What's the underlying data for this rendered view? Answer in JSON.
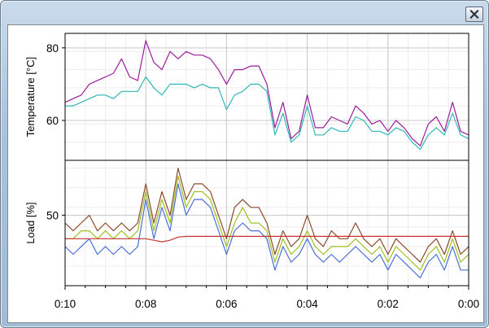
{
  "window": {
    "close_icon": "close-icon"
  },
  "chart_data": [
    {
      "type": "line",
      "ylabel": "Temperature [°C]",
      "xlabel": "",
      "x_ticks": [
        "0:10",
        "0:08",
        "0:06",
        "0:04",
        "0:02",
        "0:00"
      ],
      "y_ticks": [
        60,
        80
      ],
      "xlim": [
        10,
        0
      ],
      "ylim": [
        49,
        84
      ],
      "grid": true,
      "x": [
        10.0,
        9.8,
        9.6,
        9.4,
        9.2,
        9.0,
        8.8,
        8.6,
        8.4,
        8.2,
        8.0,
        7.8,
        7.6,
        7.4,
        7.2,
        7.0,
        6.8,
        6.6,
        6.4,
        6.2,
        6.0,
        5.8,
        5.6,
        5.4,
        5.2,
        5.0,
        4.8,
        4.6,
        4.4,
        4.2,
        4.0,
        3.8,
        3.6,
        3.4,
        3.2,
        3.0,
        2.8,
        2.6,
        2.4,
        2.2,
        2.0,
        1.8,
        1.6,
        1.4,
        1.2,
        1.0,
        0.8,
        0.6,
        0.4,
        0.2,
        0.0
      ],
      "series": [
        {
          "color": "#9c1c9c",
          "values": [
            65,
            66,
            67,
            70,
            71,
            72,
            73,
            77,
            72,
            71,
            82,
            76,
            74,
            79,
            77,
            79,
            78,
            78,
            77,
            74,
            70,
            74,
            74,
            75,
            75,
            70,
            58,
            65,
            55,
            57,
            67,
            58,
            58,
            61,
            60,
            59,
            64,
            62,
            59,
            60,
            57,
            60,
            58,
            55,
            53,
            59,
            61,
            57,
            65,
            57,
            56
          ]
        },
        {
          "color": "#2eb8b8",
          "values": [
            64,
            64,
            65,
            66,
            67,
            67,
            66,
            68,
            68,
            68,
            72,
            69,
            67,
            70,
            70,
            70,
            69,
            70,
            69,
            69,
            63,
            67,
            68,
            70,
            70,
            68,
            56,
            62,
            54,
            56,
            64,
            56,
            56,
            58,
            57,
            57,
            61,
            60,
            57,
            57,
            56,
            58,
            57,
            54,
            52,
            56,
            58,
            56,
            62,
            56,
            55
          ]
        }
      ]
    },
    {
      "type": "line",
      "ylabel": "Load [%]",
      "xlabel": "",
      "x_ticks": [
        "0:10",
        "0:08",
        "0:06",
        "0:04",
        "0:02",
        "0:00"
      ],
      "y_ticks": [
        50
      ],
      "xlim": [
        10,
        0
      ],
      "ylim": [
        41,
        57
      ],
      "grid": true,
      "x": [
        10.0,
        9.8,
        9.6,
        9.4,
        9.2,
        9.0,
        8.8,
        8.6,
        8.4,
        8.2,
        8.0,
        7.8,
        7.6,
        7.4,
        7.2,
        7.0,
        6.8,
        6.6,
        6.4,
        6.2,
        6.0,
        5.8,
        5.6,
        5.4,
        5.2,
        5.0,
        4.8,
        4.6,
        4.4,
        4.2,
        4.0,
        3.8,
        3.6,
        3.4,
        3.2,
        3.0,
        2.8,
        2.6,
        2.4,
        2.2,
        2.0,
        1.8,
        1.6,
        1.4,
        1.2,
        1.0,
        0.8,
        0.6,
        0.4,
        0.2,
        0.0
      ],
      "series": [
        {
          "color": "#8b4a2a",
          "values": [
            49,
            48,
            49,
            50,
            48,
            49,
            48,
            49,
            48,
            49,
            54,
            49,
            53,
            50,
            56,
            52,
            54,
            54,
            53,
            50,
            47,
            51,
            52,
            51,
            51,
            49,
            45,
            48,
            46,
            47,
            50,
            47,
            46,
            48,
            47,
            47,
            49,
            47,
            46,
            47,
            45,
            47,
            46,
            45,
            44,
            46,
            47,
            45,
            48,
            45,
            46
          ]
        },
        {
          "color": "#9fbf1f",
          "values": [
            47,
            47,
            48,
            48,
            47,
            48,
            47,
            48,
            47,
            48,
            53,
            48,
            52,
            49,
            55,
            51,
            53,
            53,
            52,
            49,
            46,
            49,
            51,
            49,
            49,
            48,
            44,
            47,
            45,
            46,
            48,
            46,
            45,
            46,
            46,
            46,
            47,
            46,
            45,
            46,
            44,
            46,
            45,
            44,
            43,
            45,
            46,
            44,
            47,
            44,
            45
          ]
        },
        {
          "color": "#4a6fd8",
          "values": [
            46,
            45,
            46,
            47,
            45,
            46,
            45,
            46,
            45,
            46,
            52,
            47,
            51,
            48,
            54,
            50,
            52,
            52,
            51,
            48,
            45,
            48,
            49,
            48,
            48,
            47,
            43,
            46,
            44,
            45,
            47,
            45,
            44,
            45,
            44,
            45,
            46,
            45,
            44,
            45,
            43,
            45,
            44,
            43,
            42,
            44,
            45,
            43,
            46,
            43,
            43
          ]
        },
        {
          "color": "#c83232",
          "values": [
            47,
            47,
            47,
            47,
            47,
            47,
            47,
            47,
            47,
            47,
            47,
            46.8,
            46.6,
            46.8,
            47.2,
            47.3,
            47.3,
            47.3,
            47.3,
            47.3,
            47.3,
            47.3,
            47.3,
            47.3,
            47.3,
            47.3,
            47.3,
            47.3,
            47.3,
            47.3,
            47.3,
            47.3,
            47.3,
            47.3,
            47.3,
            47.3,
            47.3,
            47.3,
            47.3,
            47.3,
            47.3,
            47.3,
            47.3,
            47.3,
            47.3,
            47.3,
            47.3,
            47.3,
            47.3,
            47.3,
            47.3
          ]
        }
      ]
    }
  ]
}
